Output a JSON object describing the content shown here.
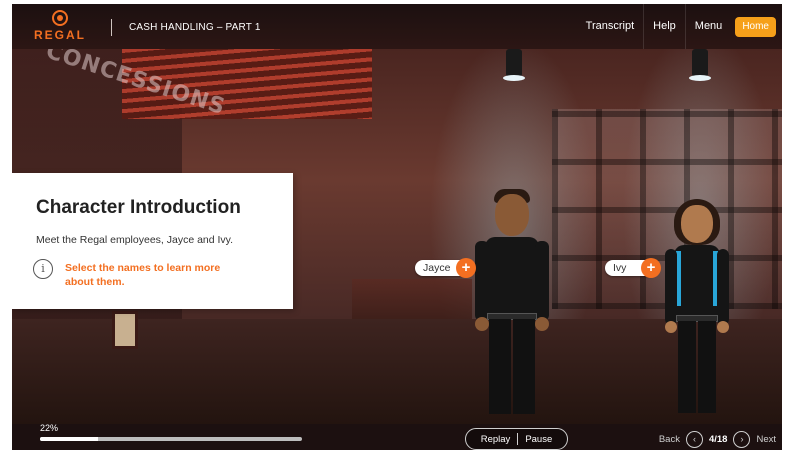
{
  "header": {
    "logo_text": "REGAL",
    "course_title": "CASH HANDLING – PART 1",
    "nav": {
      "transcript": "Transcript",
      "help": "Help",
      "menu": "Menu",
      "home": "Home"
    }
  },
  "scene": {
    "sign_text": "CONCESSIONS"
  },
  "card": {
    "title": "Character Introduction",
    "body": "Meet the Regal employees, Jayce and Ivy.",
    "info_icon": "i",
    "hint": "Select the names to learn more about them."
  },
  "characters": [
    {
      "name": "Jayce",
      "plus_icon": "+"
    },
    {
      "name": "Ivy",
      "plus_icon": "+"
    }
  ],
  "footer": {
    "progress_label": "22%",
    "progress_value": 0.22,
    "replay": "Replay",
    "pause": "Pause",
    "back": "Back",
    "page_count": "4/18",
    "next": "Next",
    "prev_arrow": "‹",
    "next_arrow": "›"
  },
  "colors": {
    "brand_orange": "#f36f21",
    "home_button": "#f6a01a",
    "uniform_trim": "#29a6d8"
  },
  "icons": [
    "regal-logo-icon",
    "info-icon",
    "plus-icon",
    "chevron-left-icon",
    "chevron-right-icon"
  ]
}
